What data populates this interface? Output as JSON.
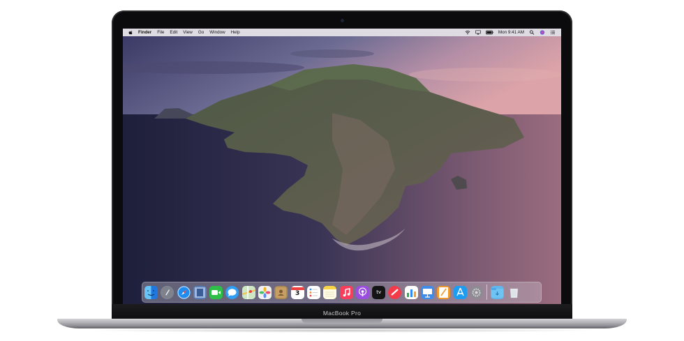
{
  "device": {
    "model_label": "MacBook Pro"
  },
  "menubar": {
    "apple_icon": "apple-logo-icon",
    "items": [
      "Finder",
      "File",
      "Edit",
      "View",
      "Go",
      "Window",
      "Help"
    ],
    "status": {
      "wifi_icon": "wifi-icon",
      "airplay_icon": "airplay-icon",
      "battery_icon": "battery-icon",
      "clock": "Mon 9:41 AM",
      "search_icon": "spotlight-search-icon",
      "siri_icon": "siri-icon",
      "notification_icon": "notification-center-icon"
    }
  },
  "desktop": {
    "wallpaper": "catalina-island-wallpaper"
  },
  "dock": {
    "apps": [
      {
        "name": "finder",
        "icon": "finder-icon",
        "color": "#2a8ff0"
      },
      {
        "name": "launchpad",
        "icon": "launchpad-icon",
        "color": "#8a8f99"
      },
      {
        "name": "safari",
        "icon": "safari-icon",
        "color": "#1b7de6"
      },
      {
        "name": "photo-booth",
        "icon": "photo-booth-icon",
        "color": "#5a7fb8"
      },
      {
        "name": "facetime",
        "icon": "facetime-icon",
        "color": "#2fbf48"
      },
      {
        "name": "messages",
        "icon": "messages-icon",
        "color": "#2f9ff5"
      },
      {
        "name": "maps",
        "icon": "maps-icon",
        "color": "#6fb96a"
      },
      {
        "name": "photos",
        "icon": "photos-icon",
        "color": "#f1f1f1"
      },
      {
        "name": "contacts",
        "icon": "contacts-icon",
        "color": "#b08a55"
      },
      {
        "name": "calendar",
        "icon": "calendar-icon",
        "color": "#ffffff",
        "text": "3"
      },
      {
        "name": "reminders",
        "icon": "reminders-icon",
        "color": "#ffffff"
      },
      {
        "name": "notes",
        "icon": "notes-icon",
        "color": "#f7d448"
      },
      {
        "name": "music",
        "icon": "music-icon",
        "color": "#fa3d5b"
      },
      {
        "name": "podcasts",
        "icon": "podcasts-icon",
        "color": "#9b4de0"
      },
      {
        "name": "tv",
        "icon": "apple-tv-icon",
        "color": "#141414",
        "text": "tv"
      },
      {
        "name": "news",
        "icon": "news-icon",
        "color": "#f33b4a"
      },
      {
        "name": "numbers",
        "icon": "numbers-icon",
        "color": "#ffffff"
      },
      {
        "name": "keynote",
        "icon": "keynote-icon",
        "color": "#3e8be8"
      },
      {
        "name": "pages",
        "icon": "pages-icon",
        "color": "#f09a2e"
      },
      {
        "name": "app-store",
        "icon": "app-store-icon",
        "color": "#1e9cf0"
      },
      {
        "name": "system-preferences",
        "icon": "system-preferences-icon",
        "color": "#8c8c92"
      }
    ],
    "folder": {
      "name": "downloads",
      "icon": "downloads-folder-icon",
      "color": "#5fb7ee"
    },
    "trash": {
      "name": "trash",
      "icon": "trash-icon",
      "color": "#e8ecf0"
    }
  }
}
